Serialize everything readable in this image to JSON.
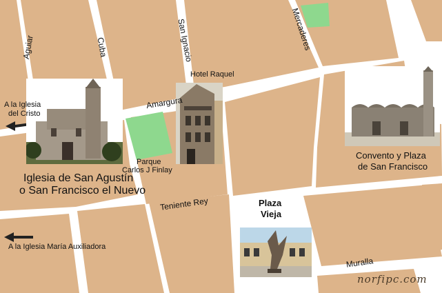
{
  "colors": {
    "block": "#ddb48a",
    "street": "#ffffff",
    "park": "#8ed88e",
    "arrow": "#222222"
  },
  "streets": {
    "aguiar": "Aguiar",
    "cuba": "Cuba",
    "san_ignacio": "San Ignacio",
    "mercaderes": "Mercaderes",
    "amargura": "Amargura",
    "teniente_rey": "Teniente Rey",
    "muralla": "Muralla"
  },
  "places": {
    "hotel_raquel": "Hotel Raquel",
    "parque_line1": "Parque",
    "parque_line2": "Carlos J Finlay",
    "iglesia_line1": "Iglesia de San Agustín",
    "iglesia_line2": "o San Francisco el Nuevo",
    "convento_line1": "Convento y Plaza",
    "convento_line2": "de San Francisco",
    "plaza_line1": "Plaza",
    "plaza_line2": "Vieja"
  },
  "directions": {
    "cristo_line1": "A la Iglesia",
    "cristo_line2": "del Cristo",
    "auxiliadora": "A la Iglesia María Auxiliadora"
  },
  "watermark": "norfipc.com"
}
